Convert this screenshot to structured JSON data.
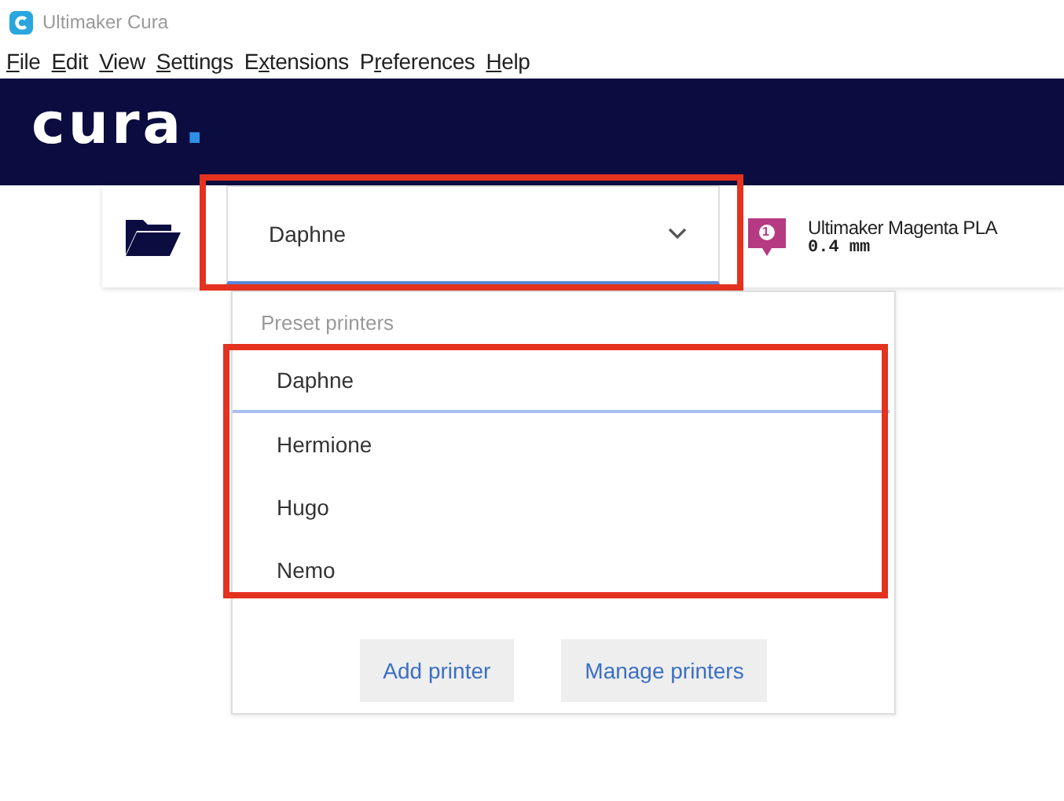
{
  "window": {
    "title": "Ultimaker Cura"
  },
  "menu": [
    {
      "key": "F",
      "after": "ile"
    },
    {
      "key": "E",
      "after": "dit"
    },
    {
      "key": "V",
      "after": "iew"
    },
    {
      "key": "S",
      "after": "ettings"
    },
    {
      "before": "E",
      "key": "x",
      "after": "tensions"
    },
    {
      "before": "P",
      "key": "r",
      "after": "eferences"
    },
    {
      "key": "H",
      "after": "elp"
    }
  ],
  "logo": {
    "text": "cura",
    "dot": "."
  },
  "printer_select": {
    "value": "Daphne",
    "expanded": true,
    "highlighted": true
  },
  "material": {
    "badge": "1",
    "name": "Ultimaker Magenta PLA",
    "nozzle": "0.4 mm"
  },
  "popup": {
    "section": "Preset printers",
    "highlighted": true,
    "printers": [
      {
        "name": "Daphne",
        "selected": true
      },
      {
        "name": "Hermione",
        "selected": false
      },
      {
        "name": "Hugo",
        "selected": false
      },
      {
        "name": "Nemo",
        "selected": false
      }
    ],
    "buttons": [
      "Add printer",
      "Manage printers"
    ]
  }
}
